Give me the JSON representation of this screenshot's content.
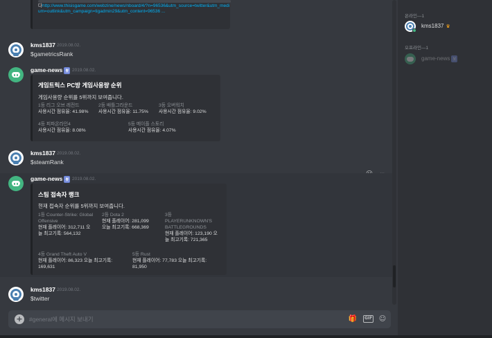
{
  "top_embed": {
    "link": "http://www.thisisgame.com/webzine/news/nboard/4/?n=96536&utm_source=twitter&utm_medium=outlink&utm_campaign=tigadmin29&utm_content=96536 ...",
    "prefix": "다"
  },
  "messages": [
    {
      "user": "kms1837",
      "time": "2019.08.02.",
      "text": "$gametricsRank"
    },
    {
      "user": "game-news",
      "bot_tag": "봇",
      "time": "2019.08.02."
    },
    {
      "user": "kms1837",
      "time": "2019.08.02.",
      "text": "$steamRank"
    },
    {
      "user": "game-news",
      "bot_tag": "봇",
      "time": "2019.08.02."
    },
    {
      "user": "kms1837",
      "time": "2019.08.02.",
      "text": "$twitter"
    }
  ],
  "embed_gametrics": {
    "title": "게임트릭스 PC방 게임사용량 순위",
    "desc": "게임사용량 순위를 5위까지 보여줍니다.",
    "fields": [
      {
        "name": "1등 리그 오브 레전드",
        "value": "사용시간 점유율: 41.98%"
      },
      {
        "name": "2등 배틀그라운드",
        "value": "사용시간 점유율: 11.75%"
      },
      {
        "name": "3등 오버워치",
        "value": "사용시간 점유율: 9.02%"
      },
      {
        "name": "4등 피파온라인4",
        "value": "사용시간 점유율: 8.08%"
      },
      {
        "name": "5등 메이플 스토리",
        "value": "사용시간 점유율: 4.07%"
      }
    ]
  },
  "embed_steam": {
    "title": "스팀 접속자 랭크",
    "desc": "현재 접속자 순위를 5위까지 보여줍니다.",
    "fields": [
      {
        "name_l1": "1등 Counter-Strike: Global",
        "name_l2": "Offensive",
        "value_l1": "현재 플레이어: 312,711 오",
        "value_l2": "늘 최고기록: 564,132"
      },
      {
        "name_l1": "2등 Dota 2",
        "name_l2": "",
        "value_l1": "현재 플레이어: 281,099",
        "value_l2": "오늘 최고기록: 668,369"
      },
      {
        "name_l1": "3등",
        "name_l2": "PLAYERUNKNOWN'S",
        "name_l3": "BATTLEGROUNDS",
        "value_l1": "현재 플레이어: 123,190 오",
        "value_l2": "늘 최고기록: 721,365"
      },
      {
        "name_l1": "4등 Grand Theft Auto V",
        "value_l1": "현재 플레이어: 86,323 오늘 최고기록:",
        "value_l2": "169,631"
      },
      {
        "name_l1": "5등 Rust",
        "value_l1": "현재 플레이어: 77,783 오늘 최고기록:",
        "value_l2": "81,950"
      }
    ]
  },
  "hover_actions": {
    "react_icon": "add-reaction-icon",
    "more_icon": "more-icon"
  },
  "composer": {
    "placeholder": "#general에 메시지 보내기",
    "icons": [
      "gift-icon",
      "gif-icon",
      "emoji-icon"
    ],
    "gif_label": "GIF"
  },
  "members": {
    "online_header": "온라인—1",
    "online": [
      {
        "name": "kms1837",
        "color": "#dcddde"
      }
    ],
    "offline_header": "오프라인—1",
    "offline": [
      {
        "name": "game-news",
        "bot_tag": "봇"
      }
    ]
  }
}
